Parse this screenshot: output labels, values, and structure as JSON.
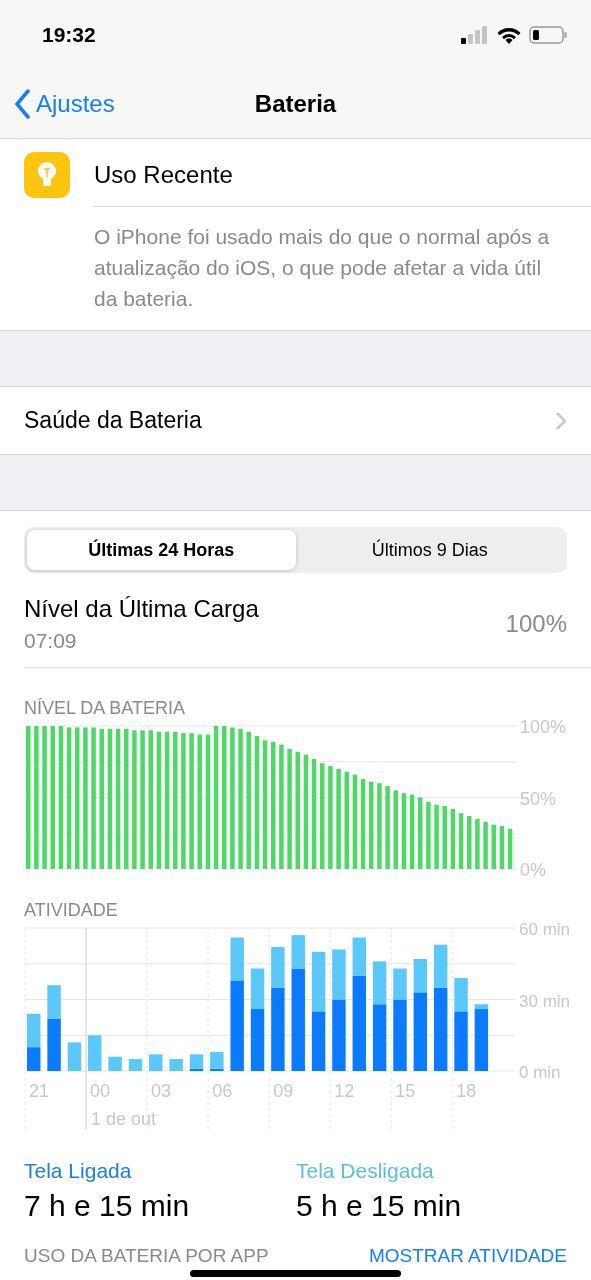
{
  "status_bar": {
    "time": "19:32"
  },
  "nav": {
    "back": "Ajustes",
    "title": "Bateria"
  },
  "recent_usage": {
    "title": "Uso Recente",
    "description": "O iPhone foi usado mais do que o normal após a atualização do iOS, o que pode afetar a vida útil da bateria."
  },
  "battery_health": {
    "label": "Saúde da Bateria"
  },
  "segments": [
    {
      "label": "Últimas 24 Horas",
      "selected": true
    },
    {
      "label": "Últimos 9 Dias",
      "selected": false
    }
  ],
  "last_charge": {
    "label": "Nível da Última Carga",
    "time": "07:09",
    "value": "100%"
  },
  "battery_level": {
    "heading": "NÍVEL DA BATERIA",
    "chart_data": {
      "type": "bar",
      "color": "#4cd964",
      "ylim": [
        0,
        100
      ],
      "yticks": [
        {
          "value": 0,
          "label": "0%"
        },
        {
          "value": 50,
          "label": "50%"
        },
        {
          "value": 100,
          "label": "100%"
        }
      ],
      "values": [
        100,
        100,
        100,
        100,
        100,
        99,
        99,
        99,
        99,
        98,
        98,
        98,
        98,
        97,
        97,
        97,
        96,
        96,
        96,
        95,
        95,
        94,
        94,
        100,
        100,
        99,
        98,
        96,
        93,
        90,
        89,
        87,
        84,
        82,
        80,
        77,
        74,
        72,
        70,
        68,
        66,
        63,
        61,
        60,
        58,
        55,
        53,
        52,
        50,
        47,
        45,
        44,
        42,
        39,
        37,
        35,
        33,
        31,
        30,
        28
      ]
    }
  },
  "activity": {
    "heading": "ATIVIDADE",
    "date_label": "1 de out",
    "chart_data": {
      "type": "bar",
      "stacked": true,
      "categories": [
        "21",
        null,
        null,
        "00",
        null,
        null,
        "03",
        null,
        null,
        "06",
        null,
        null,
        "09",
        null,
        null,
        "12",
        null,
        null,
        "15",
        null,
        null,
        "18",
        null
      ],
      "ylim": [
        0,
        60
      ],
      "yticks": [
        {
          "value": 0,
          "label": "0 min"
        },
        {
          "value": 30,
          "label": "30 min"
        },
        {
          "value": 60,
          "label": "60 min"
        }
      ],
      "series": [
        {
          "color": "#0a7aff",
          "values": [
            10,
            22,
            0,
            0,
            0,
            0,
            0,
            0,
            1,
            1,
            38,
            26,
            35,
            43,
            25,
            30,
            40,
            28,
            30,
            33,
            35,
            25,
            26
          ]
        },
        {
          "color": "#5ac8fa",
          "values": [
            14,
            14,
            12,
            15,
            6,
            5,
            7,
            5,
            6,
            7,
            18,
            17,
            17,
            14,
            25,
            21,
            16,
            18,
            13,
            14,
            18,
            14,
            2
          ]
        }
      ]
    }
  },
  "totals": [
    {
      "label": "Tela Ligada",
      "value": "7 h e 15 min",
      "color": "#1a7fe0"
    },
    {
      "label": "Tela Desligada",
      "value": "5 h e 15 min",
      "color": "#5bbfe0"
    }
  ],
  "app_usage": {
    "heading": "USO DA BATERIA POR APP",
    "action": "MOSTRAR ATIVIDADE"
  }
}
